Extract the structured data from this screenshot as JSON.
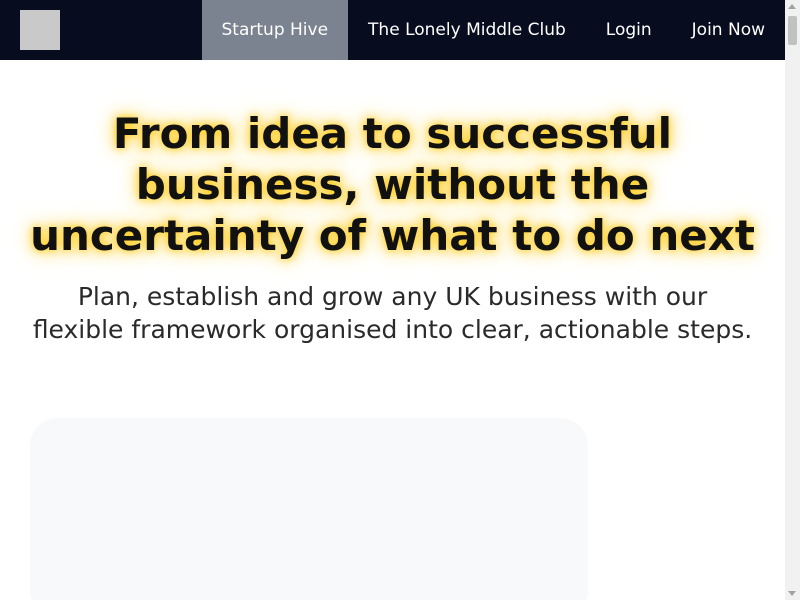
{
  "header": {
    "logo_icon": "logo-placeholder-icon",
    "nav": [
      {
        "label": "Startup Hive",
        "active": true
      },
      {
        "label": "The Lonely Middle Club",
        "active": false
      },
      {
        "label": "Login",
        "active": false
      },
      {
        "label": "Join Now",
        "active": false
      }
    ]
  },
  "hero": {
    "title": "From idea to successful business, without the uncertainty of what to do next",
    "subtitle": "Plan, establish and grow any UK business with our flexible framework organised into clear, actionable steps."
  },
  "colors": {
    "navbar_bg": "#070c1f",
    "active_nav_bg": "#7b8390",
    "title_glow": "#ffc800",
    "card_bg": "#f8f9fb"
  }
}
